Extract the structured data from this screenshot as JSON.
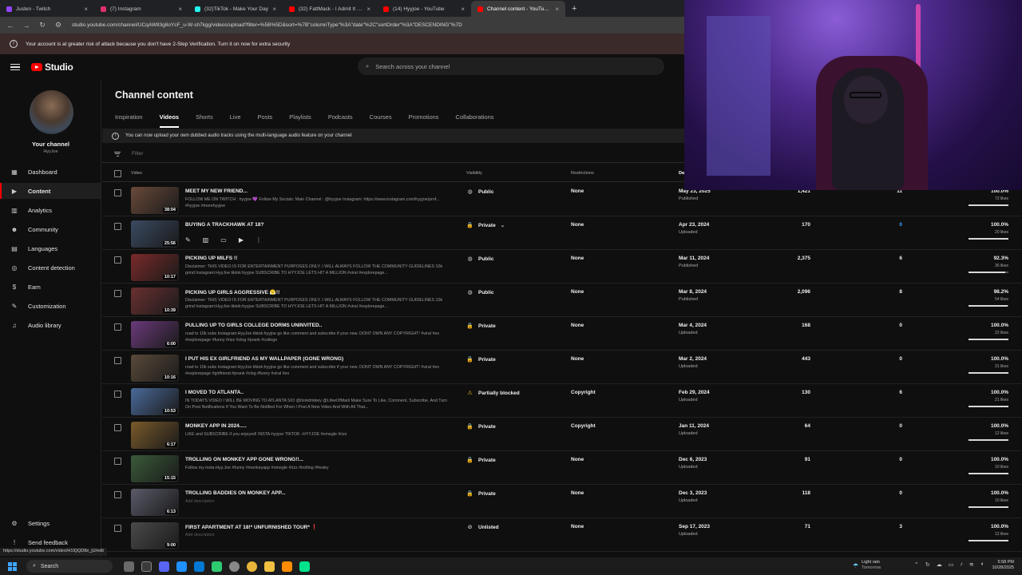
{
  "browser": {
    "tabs": [
      {
        "title": "Justen - Twitch",
        "color": "#9146ff",
        "active": false
      },
      {
        "title": "(7) Instagram",
        "color": "#e1306c",
        "active": false
      },
      {
        "title": "(32)TikTok - Make Your Day",
        "color": "#25f4ee",
        "active": false
      },
      {
        "title": "(32) FattMack - I Admit It [Offi",
        "color": "#ff0000",
        "active": false
      },
      {
        "title": "(14) Hyyjoe - YouTube",
        "color": "#ff0000",
        "active": false
      },
      {
        "title": "Channel content - YouTube Stu",
        "color": "#ff0000",
        "active": true
      }
    ],
    "new_tab": "+",
    "url": "studio.youtube.com/channel/UCqAW83g8oYcF_u-W-sh7kgg/videos/upload?filter=%5B%5D&sort=%7B\"columnType\"%3A\"date\"%2C\"sortOrder\"%3A\"DESCENDING\"%7D"
  },
  "banner": {
    "text": "Your account is at greater risk of attack because you don't have 2-Step Verification. Turn it on now for extra security"
  },
  "header": {
    "logo_text": "Studio",
    "search_placeholder": "Search across your channel"
  },
  "sidebar": {
    "channel_name": "Your channel",
    "channel_handle": "HyyJoe",
    "items": [
      {
        "label": "Dashboard",
        "icon": "▦"
      },
      {
        "label": "Content",
        "icon": "▶"
      },
      {
        "label": "Analytics",
        "icon": "▥"
      },
      {
        "label": "Community",
        "icon": "☻"
      },
      {
        "label": "Languages",
        "icon": "▤"
      },
      {
        "label": "Content detection",
        "icon": "◎"
      },
      {
        "label": "Earn",
        "icon": "$"
      },
      {
        "label": "Customization",
        "icon": "✎"
      },
      {
        "label": "Audio library",
        "icon": "♫"
      }
    ],
    "settings": "Settings",
    "feedback": "Send feedback"
  },
  "main": {
    "title": "Channel content",
    "tabs": [
      "Inspiration",
      "Videos",
      "Shorts",
      "Live",
      "Posts",
      "Playlists",
      "Podcasts",
      "Courses",
      "Promotions",
      "Collaborations"
    ],
    "info": "You can now upload your own dubbed audio tracks using the multi-language audio feature on your channel",
    "filter_placeholder": "Filter",
    "columns": {
      "video": "Video",
      "visibility": "Visibility",
      "restrictions": "Restrictions",
      "date": "Da"
    }
  },
  "videos": [
    {
      "title": "MEET MY NEW FRIEND...",
      "desc": "FOLLOW ME ON TWITCH : hyyjoe 💜 Follow My Socials: Main Channel : @hyyjoe Instagram: https://www.instagram.com/hyyjoe/prof... #hyyjoe #morehyyjoe",
      "duration": "38:04",
      "visibility": "Public",
      "vis_icon": "◍",
      "restrictions": "None",
      "date": "May 23, 2025",
      "status": "Published",
      "views": "1,421",
      "comments": "11",
      "ratio": "100.0%",
      "likes": "72 likes",
      "ratio_pct": 100,
      "thumb": "#6a4a3a"
    },
    {
      "title": "BUYING A TRACKHAWK AT 18?",
      "desc": "",
      "duration": "25:56",
      "visibility": "Private",
      "vis_icon": "🔒",
      "restrictions": "None",
      "date": "Apr 23, 2024",
      "status": "Uploaded",
      "views": "170",
      "comments": "0",
      "ratio": "100.0%",
      "likes": "20 likes",
      "ratio_pct": 100,
      "thumb": "#3a4a62"
    },
    {
      "title": "PICKING UP MILFS !!",
      "desc": "Disclaimer: THIS VIDEO IS FOR ENTERTAINMENT PURPOSES ONLY. I WILL ALWAYS FOLLOW THE COMMUNITY GUIDELINES 10k grind Instagram:HyyJoe tiktok:hyyjoe SUBSCRIBE TO HYYJOE LETS HIT A MILLION #viral #explorepage...",
      "duration": "10:17",
      "visibility": "Public",
      "vis_icon": "◍",
      "restrictions": "None",
      "date": "Mar 11, 2024",
      "status": "Published",
      "views": "2,375",
      "comments": "6",
      "ratio": "92.3%",
      "likes": "36 likes",
      "ratio_pct": 92.3,
      "thumb": "#7a2a2a"
    },
    {
      "title": "PICKING UP GIRLS AGGRESSIVE 😤!!",
      "desc": "Disclaimer: THIS VIDEO IS FOR ENTERTAINMENT PURPOSES ONLY. I WILL ALWAYS FOLLOW THE COMMUNITY GUIDELINES 10k grind Instagram:HyyJoe tiktok:hyyjoe SUBSCRIBE TO HYYJOE LETS HIT A MILLION #viral #explorepage...",
      "duration": "10:39",
      "visibility": "Public",
      "vis_icon": "◍",
      "restrictions": "None",
      "date": "Mar 8, 2024",
      "status": "Published",
      "views": "2,096",
      "comments": "8",
      "ratio": "98.2%",
      "likes": "54 likes",
      "ratio_pct": 98.2,
      "thumb": "#6a3030"
    },
    {
      "title": "PULLING UP TO GIRLS COLLEGE DORMS UNINVITED..",
      "desc": "road to 10k subs Instagram:HyyJoe tiktok:hyyjoe go like comment and subscribe if your new. DONT OWN ANY COPYRIGHT! #viral #ex #explorepage #funny #rizz #vlog #prank #college",
      "duration": "6:00",
      "visibility": "Private",
      "vis_icon": "🔒",
      "restrictions": "None",
      "date": "Mar 4, 2024",
      "status": "Uploaded",
      "views": "168",
      "comments": "0",
      "ratio": "100.0%",
      "likes": "22 likes",
      "ratio_pct": 100,
      "thumb": "#6a3a7a"
    },
    {
      "title": "I PUT HIS EX GIRLFRIEND AS MY WALLPAPER (GONE WRONG)",
      "desc": "road to 10k subs Instagram:HyyJoe tiktok:hyyjoe go like comment and subscribe if your new. DONT OWN ANY COPYRIGHT! #viral #ex #explorepage #girlfriend #prank #vlog #funny #viral #ex",
      "duration": "10:16",
      "visibility": "Private",
      "vis_icon": "🔒",
      "restrictions": "None",
      "date": "Mar 2, 2024",
      "status": "Uploaded",
      "views": "443",
      "comments": "0",
      "ratio": "100.0%",
      "likes": "31 likes",
      "ratio_pct": 100,
      "thumb": "#5a4a3a"
    },
    {
      "title": "I MOVED TO ATLANTA..",
      "desc": "IN TODAYS VIDEO I WILL BE MOVING TO ATLANTA S/O @Itsrkdmikey @LifeeOfMarii Make Sure To Like, Comment, Subscribe, And Turn On Post Notifications If You Want To Be Notified For When I Post A New Video And With All That...",
      "duration": "10:53",
      "visibility": "Partially blocked",
      "vis_icon": "⚠",
      "restrictions": "Copyright",
      "date": "Feb 29, 2024",
      "status": "Uploaded",
      "views": "130",
      "comments": "6",
      "ratio": "100.0%",
      "likes": "21 likes",
      "ratio_pct": 100,
      "thumb": "#4a6a9a"
    },
    {
      "title": "MONKEY APP IN 2024.....",
      "desc": "LIKE and SUBSCRIBE if you enjoyed! INSTA-hyyjoe TIKTOK -HYYJOE #omegle #rizz",
      "duration": "6:17",
      "visibility": "Private",
      "vis_icon": "🔒",
      "restrictions": "Copyright",
      "date": "Jan 11, 2024",
      "status": "Uploaded",
      "views": "64",
      "comments": "0",
      "ratio": "100.0%",
      "likes": "12 likes",
      "ratio_pct": 100,
      "thumb": "#7a5a2a"
    },
    {
      "title": "TROLLING ON MONKEY APP GONE WRONG!!...",
      "desc": "Follow my insta-Hyy.Joe #funny #monkeyapp #omegle #rizz #trolling #freaky",
      "duration": "15:15",
      "visibility": "Private",
      "vis_icon": "🔒",
      "restrictions": "None",
      "date": "Dec 6, 2023",
      "status": "Uploaded",
      "views": "91",
      "comments": "0",
      "ratio": "100.0%",
      "likes": "10 likes",
      "ratio_pct": 100,
      "thumb": "#3a5a3a"
    },
    {
      "title": "TROLLING BADDIES ON MONKEY APP...",
      "desc": "Add description",
      "desc_empty": true,
      "duration": "6:13",
      "visibility": "Private",
      "vis_icon": "🔒",
      "restrictions": "None",
      "date": "Dec 3, 2023",
      "status": "Uploaded",
      "views": "118",
      "comments": "0",
      "ratio": "100.0%",
      "likes": "10 likes",
      "ratio_pct": 100,
      "thumb": "#5a5a6a"
    },
    {
      "title": "FIRST APARTMENT AT 18!* UNFURNISHED TOUR* ❗",
      "desc": "Add description",
      "desc_empty": true,
      "duration": "9:00",
      "visibility": "Unlisted",
      "vis_icon": "⊘",
      "restrictions": "None",
      "date": "Sep 17, 2023",
      "status": "Uploaded",
      "views": "71",
      "comments": "3",
      "ratio": "100.0%",
      "likes": "12 likes",
      "ratio_pct": 100,
      "thumb": "#4a4a4a"
    }
  ],
  "status_url": "https://studio.youtube.com/video/H1lQQD8e_jU/edit",
  "taskbar": {
    "search": "Search",
    "weather_title": "Light rain",
    "weather_sub": "Tomorrow",
    "time": "5:58 PM",
    "date": "10/28/2025"
  }
}
